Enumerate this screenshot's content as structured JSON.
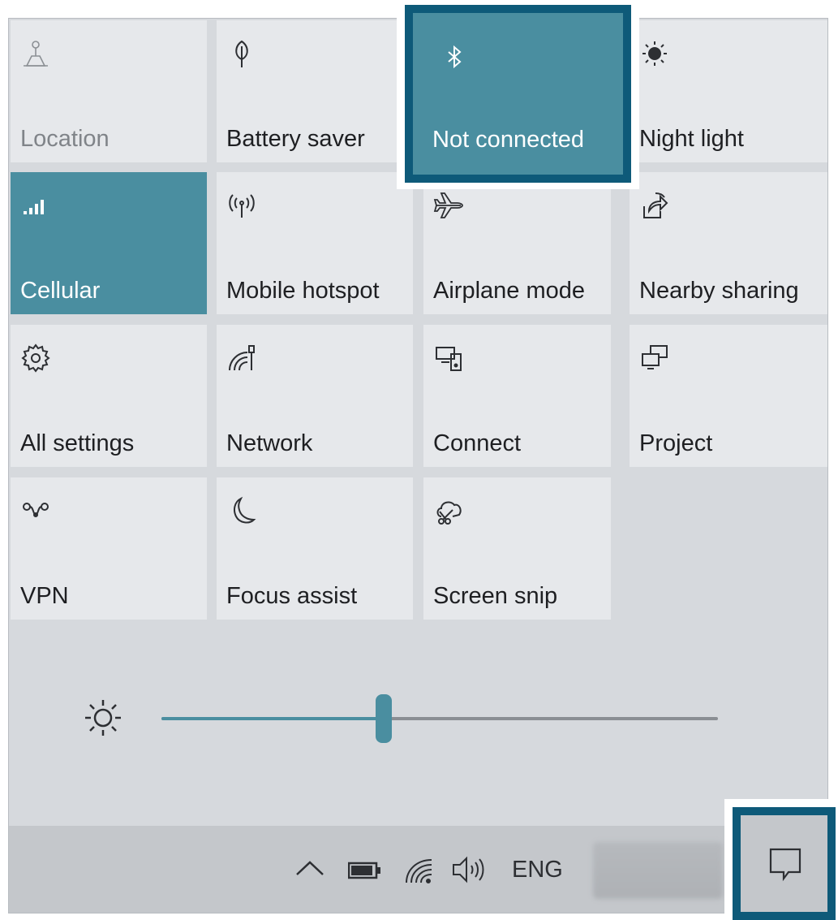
{
  "tiles": [
    {
      "label": "Location",
      "icon": "location-icon",
      "state": "disabled"
    },
    {
      "label": "Battery saver",
      "icon": "battery-saver-icon",
      "state": "normal"
    },
    {
      "label": "Not connected",
      "icon": "bluetooth-icon",
      "state": "active"
    },
    {
      "label": "Night light",
      "icon": "night-light-icon",
      "state": "normal"
    },
    {
      "label": "Cellular",
      "icon": "cellular-icon",
      "state": "active"
    },
    {
      "label": "Mobile hotspot",
      "icon": "mobile-hotspot-icon",
      "state": "normal"
    },
    {
      "label": "Airplane mode",
      "icon": "airplane-icon",
      "state": "normal"
    },
    {
      "label": "Nearby sharing",
      "icon": "nearby-sharing-icon",
      "state": "normal"
    },
    {
      "label": "All settings",
      "icon": "gear-icon",
      "state": "normal"
    },
    {
      "label": "Network",
      "icon": "network-icon",
      "state": "normal"
    },
    {
      "label": "Connect",
      "icon": "connect-icon",
      "state": "normal"
    },
    {
      "label": "Project",
      "icon": "project-icon",
      "state": "normal"
    },
    {
      "label": "VPN",
      "icon": "vpn-icon",
      "state": "normal"
    },
    {
      "label": "Focus assist",
      "icon": "moon-icon",
      "state": "normal"
    },
    {
      "label": "Screen snip",
      "icon": "screen-snip-icon",
      "state": "normal"
    }
  ],
  "brightness": {
    "level": 0.4,
    "icon": "brightness-icon"
  },
  "taskbar": {
    "language": "ENG",
    "icons": [
      "chevron-up-icon",
      "battery-icon",
      "wifi-icon",
      "volume-icon",
      "action-center-icon"
    ]
  },
  "colors": {
    "accent": "#4a8ea0",
    "highlight": "#0e5a79",
    "tile": "#e6e8eb",
    "panel": "#d6d9dd"
  }
}
